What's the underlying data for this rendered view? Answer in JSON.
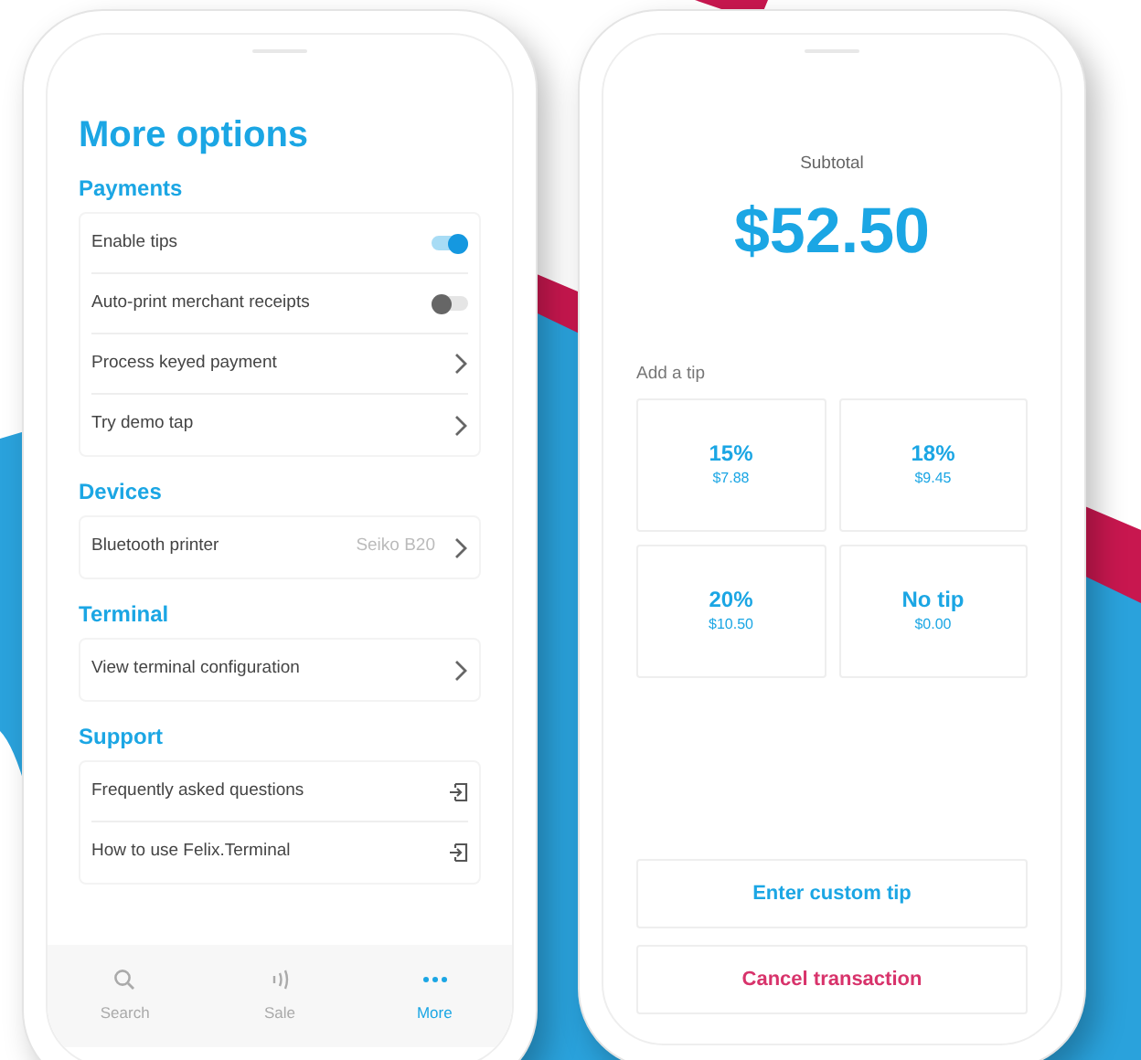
{
  "options_screen": {
    "title": "More options",
    "sections": [
      {
        "heading": "Payments",
        "items": [
          {
            "kind": "toggle",
            "label": "Enable tips",
            "on": true
          },
          {
            "kind": "toggle",
            "label": "Auto-print merchant receipts",
            "on": false
          },
          {
            "kind": "chevron",
            "label": "Process keyed payment"
          },
          {
            "kind": "chevron",
            "label": "Try demo tap"
          }
        ]
      },
      {
        "heading": "Devices",
        "items": [
          {
            "kind": "chevron",
            "label": "Bluetooth printer",
            "value": "Seiko B20"
          }
        ]
      },
      {
        "heading": "Terminal",
        "items": [
          {
            "kind": "chevron",
            "label": "View terminal configuration"
          }
        ]
      },
      {
        "heading": "Support",
        "items": [
          {
            "kind": "external",
            "label": "Frequently asked questions"
          },
          {
            "kind": "external",
            "label": "How to use Felix.Terminal"
          }
        ]
      }
    ],
    "tab_bar": [
      {
        "label": "Search",
        "selected": false
      },
      {
        "label": "Sale",
        "selected": false
      },
      {
        "label": "More",
        "selected": true
      }
    ]
  },
  "tip_screen": {
    "subtotal_label": "Subtotal",
    "subtotal": "$52.50",
    "tip_heading": "Add a tip",
    "tips": [
      {
        "label": "15%",
        "amount": "$7.88"
      },
      {
        "label": "18%",
        "amount": "$9.45"
      },
      {
        "label": "20%",
        "amount": "$10.50"
      },
      {
        "label": "No tip",
        "amount": "$0.00"
      }
    ],
    "buttons": [
      {
        "kind": "primary",
        "label": "Enter custom tip"
      },
      {
        "kind": "danger",
        "label": "Cancel transaction"
      }
    ]
  }
}
